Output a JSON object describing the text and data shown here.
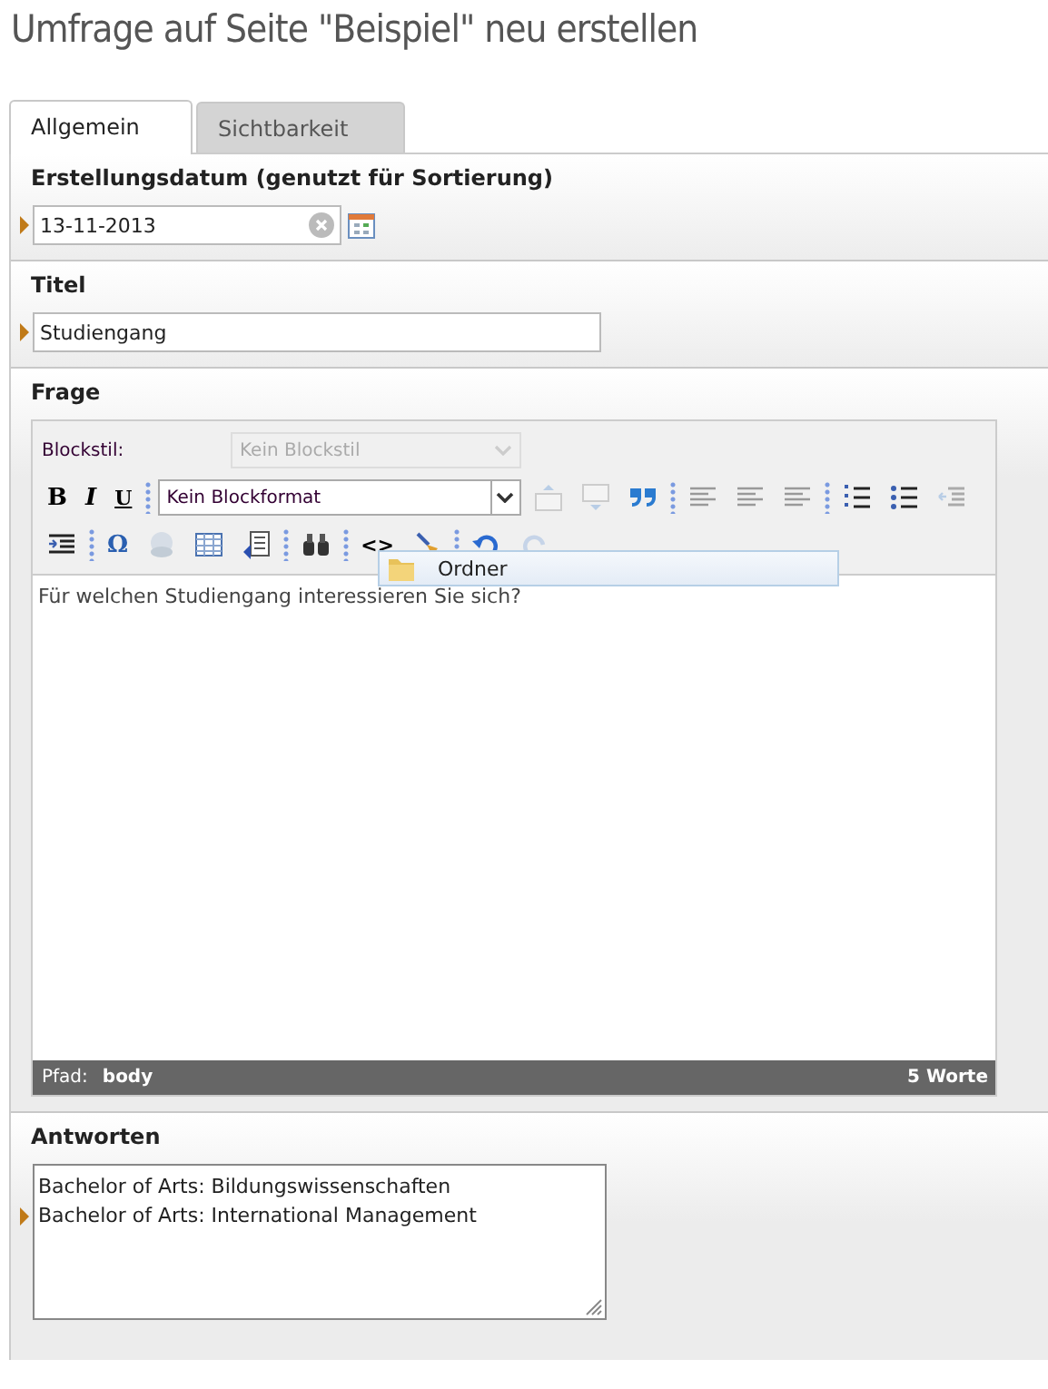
{
  "page_title": "Umfrage auf Seite \"Beispiel\" neu erstellen",
  "tabs": [
    {
      "label": "Allgemein",
      "selected": true
    },
    {
      "label": "Sichtbarkeit",
      "selected": false
    }
  ],
  "date_field": {
    "label": "Erstellungsdatum (genutzt für Sortierung)",
    "value": "13-11-2013"
  },
  "title_field": {
    "label": "Titel",
    "value": "Studiengang"
  },
  "question": {
    "label": "Frage",
    "blockstyle_label": "Blockstil:",
    "blockstyle_value": "Kein Blockstil",
    "blockformat_value": "Kein Blockformat",
    "format_glyphs": [
      "B",
      "I",
      "U"
    ],
    "special_glyph": "Ω",
    "code_glyph": "<>",
    "popup_item": "Ordner",
    "content": "Für welchen Studiengang interessieren Sie sich?",
    "path_label": "Pfad:",
    "path_value": "body",
    "word_count": "5 Worte"
  },
  "answers": {
    "label": "Antworten",
    "lines": [
      "Bachelor of Arts: Bildungswissenschaften",
      "Bachelor of Arts: International Management"
    ]
  }
}
